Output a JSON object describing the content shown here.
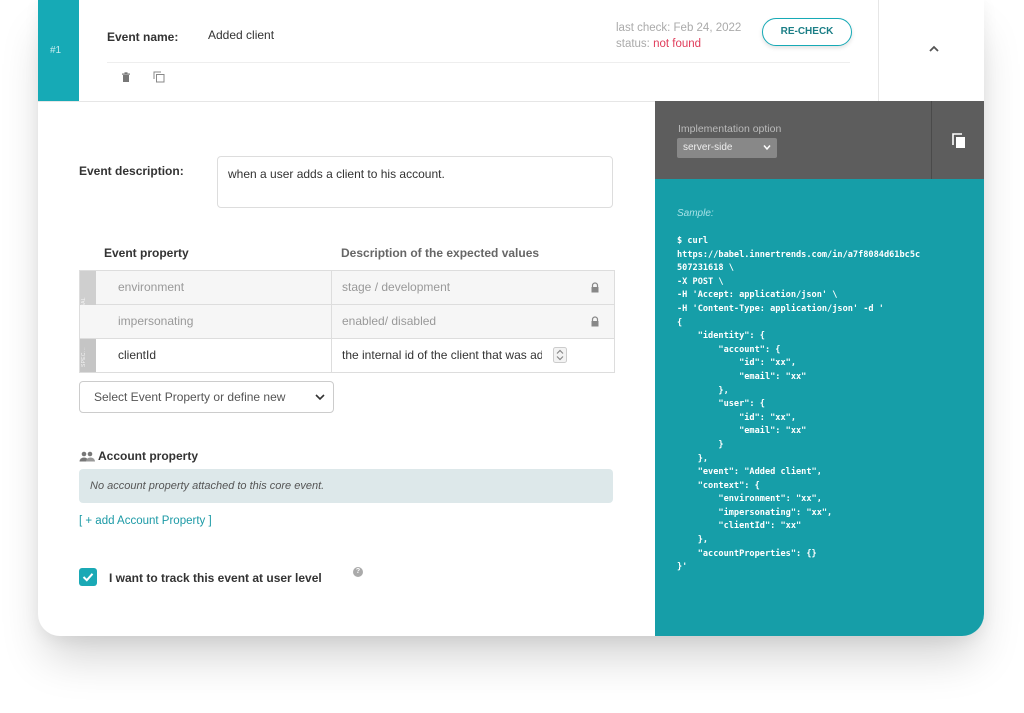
{
  "header": {
    "number": "#1",
    "event_name_label": "Event name:",
    "event_name_value": "Added client",
    "last_check": "last check: Feb 24, 2022",
    "status_label": "status:",
    "status_value": "not found",
    "recheck_label": "RE-CHECK"
  },
  "description": {
    "label": "Event description:",
    "value": "when a user adds a client to his account."
  },
  "properties": {
    "col_property": "Event property",
    "col_description": "Description of the expected values",
    "global_tag": "GLOBAL",
    "specific_tag": "SPEC...",
    "rows": [
      {
        "name": "environment",
        "desc": "stage / development"
      },
      {
        "name": "impersonating",
        "desc": "enabled/ disabled"
      },
      {
        "name": "clientId",
        "desc": "the internal id of the client that was added"
      }
    ],
    "select_placeholder": "Select Event Property or define new"
  },
  "account": {
    "title": "Account property",
    "empty_text": "No account property attached to this core event.",
    "add_link": "[ + add Account Property ]"
  },
  "track": {
    "label": "I want to track this event at user level",
    "checked": true,
    "help": "?"
  },
  "implementation": {
    "label": "Implementation option",
    "selected": "server-side"
  },
  "sample": {
    "label": "Sample:",
    "code": "$ curl\nhttps://babel.innertrends.com/in/a7f8084d61bc5c\n507231618 \\\n-X POST \\\n-H 'Accept: application/json' \\\n-H 'Content-Type: application/json' -d '\n{\n    \"identity\": {\n        \"account\": {\n            \"id\": \"xx\",\n            \"email\": \"xx\"\n        },\n        \"user\": {\n            \"id\": \"xx\",\n            \"email\": \"xx\"\n        }\n    },\n    \"event\": \"Added client\",\n    \"context\": {\n        \"environment\": \"xx\",\n        \"impersonating\": \"xx\",\n        \"clientId\": \"xx\"\n    },\n    \"accountProperties\": {}\n}'"
  },
  "colors": {
    "accent": "#16aab6",
    "code_bg": "#169ea8",
    "status_not_found": "#e03c5a",
    "impl_bg": "#5d5d5d"
  },
  "icons": [
    "trash-icon",
    "duplicate-icon",
    "chevron-up-icon",
    "lock-icon",
    "spinner-icon",
    "caret-down-icon",
    "users-icon",
    "checkmark-icon",
    "help-icon",
    "copy-icon"
  ]
}
